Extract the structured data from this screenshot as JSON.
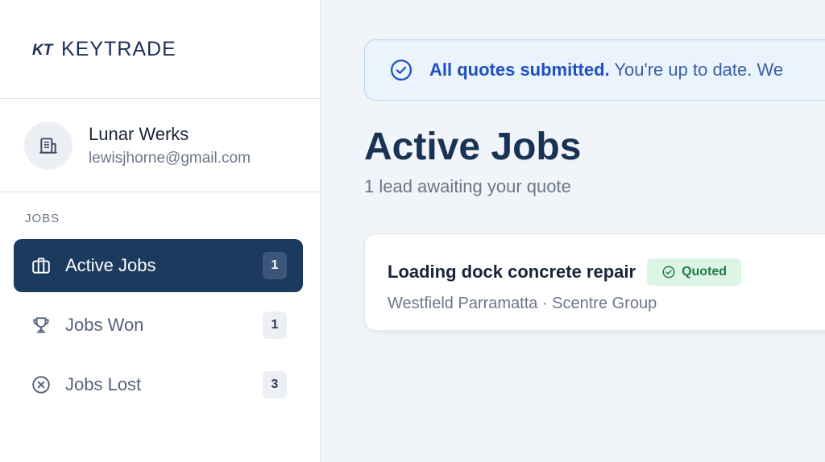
{
  "brand": {
    "logo_mark": "KT",
    "name": "KEYTRADE"
  },
  "profile": {
    "name": "Lunar Werks",
    "email": "lewisjhorne@gmail.com",
    "avatar_icon": "building-icon"
  },
  "nav": {
    "section_label": "JOBS",
    "items": [
      {
        "label": "Active Jobs",
        "count": "1",
        "icon": "briefcase-icon",
        "active": true
      },
      {
        "label": "Jobs Won",
        "count": "1",
        "icon": "trophy-icon",
        "active": false
      },
      {
        "label": "Jobs Lost",
        "count": "3",
        "icon": "x-circle-icon",
        "active": false
      }
    ]
  },
  "alert": {
    "icon": "check-circle-icon",
    "title": "All quotes submitted.",
    "body": "You're up to date. We"
  },
  "page": {
    "title": "Active Jobs",
    "subtitle": "1 lead awaiting your quote"
  },
  "jobs": [
    {
      "title": "Loading dock concrete repair",
      "status": "Quoted",
      "meta": "Westfield Parramatta · Scentre Group"
    }
  ],
  "colors": {
    "accent": "#1c3a5e",
    "alert_bg": "#ebf3fc",
    "alert_text": "#1f4fc0",
    "status_bg": "#ddf5e5",
    "status_text": "#1e7a43"
  }
}
